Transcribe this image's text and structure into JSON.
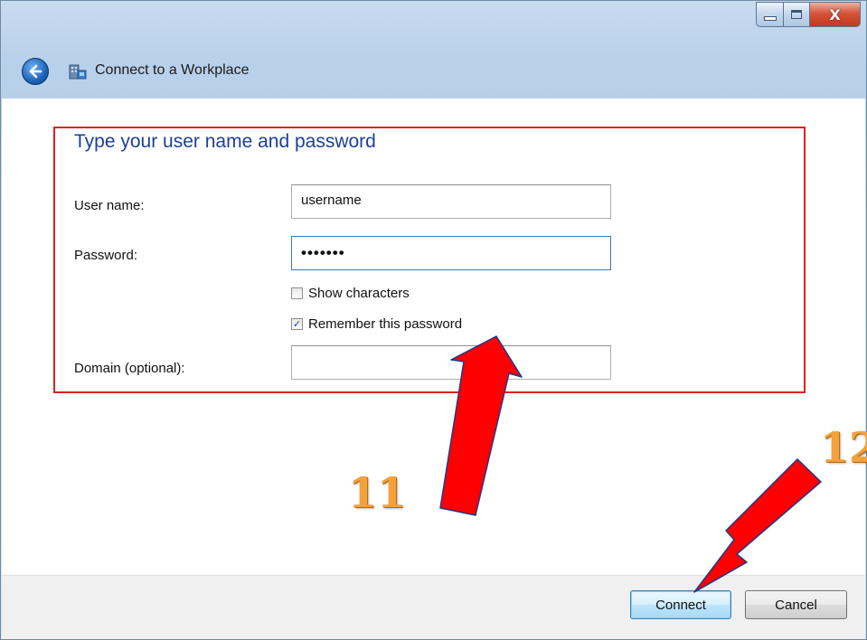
{
  "window": {
    "title": "Connect to a Workplace",
    "controls": {
      "minimize": "minimize",
      "maximize": "maximize",
      "close": "X"
    }
  },
  "icons": {
    "back": "back-arrow-icon",
    "app": "network-workplace-icon"
  },
  "form": {
    "heading": "Type your user name and password",
    "username_label": "User name:",
    "username_value": "username",
    "password_label": "Password:",
    "password_value": "•••••••",
    "show_characters_label": "Show characters",
    "show_characters_checked": false,
    "remember_label": "Remember this password",
    "remember_checked": true,
    "domain_label": "Domain (optional):",
    "domain_value": ""
  },
  "buttons": {
    "connect": "Connect",
    "cancel": "Cancel"
  },
  "annotations": {
    "step_11": "11",
    "step_12": "12",
    "highlight_color": "#e02020",
    "arrow_color": "#ff0000",
    "number_color": "#f4a13a"
  }
}
